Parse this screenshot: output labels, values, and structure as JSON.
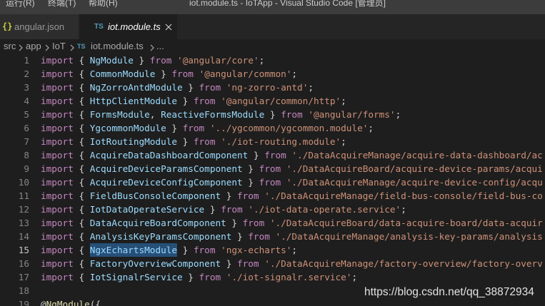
{
  "titlebar": {
    "menu": [
      "运行(R)",
      "终端(T)",
      "帮助(H)"
    ],
    "title": "iot.module.ts - IoTApp - Visual Studio Code [管理员]"
  },
  "tabs": [
    {
      "icon": "json-file-icon",
      "icon_glyph": "{}",
      "icon_color": "#cbcb41",
      "label": "angular.json",
      "active": false
    },
    {
      "icon": "typescript-file-icon",
      "icon_glyph": "TS",
      "icon_color": "#519aba",
      "label": "iot.module.ts",
      "active": true,
      "close_icon": "close-icon"
    }
  ],
  "breadcrumb": {
    "items": [
      "src",
      "app",
      "IoT",
      "iot.module.ts",
      "..."
    ],
    "separator_icon": "chevron-right-icon",
    "file_icon": "typescript-file-icon",
    "file_icon_glyph": "TS",
    "file_icon_color": "#519aba"
  },
  "editor": {
    "lines": [
      {
        "number": "1",
        "tokens": [
          {
            "text": "import",
            "color": "#c586c0"
          },
          {
            "text": " { ",
            "color": "#d4d4d4"
          },
          {
            "text": "NgModule",
            "color": "#9cdcfe"
          },
          {
            "text": " } ",
            "color": "#d4d4d4"
          },
          {
            "text": "from",
            "color": "#c586c0"
          },
          {
            "text": " ",
            "color": "#d4d4d4"
          },
          {
            "text": "'@angular/core'",
            "color": "#ce9178"
          },
          {
            "text": ";",
            "color": "#d4d4d4"
          }
        ]
      },
      {
        "number": "2",
        "tokens": [
          {
            "text": "import",
            "color": "#c586c0"
          },
          {
            "text": " { ",
            "color": "#d4d4d4"
          },
          {
            "text": "CommonModule",
            "color": "#9cdcfe"
          },
          {
            "text": " } ",
            "color": "#d4d4d4"
          },
          {
            "text": "from",
            "color": "#c586c0"
          },
          {
            "text": " ",
            "color": "#d4d4d4"
          },
          {
            "text": "'@angular/common'",
            "color": "#ce9178"
          },
          {
            "text": ";",
            "color": "#d4d4d4"
          }
        ]
      },
      {
        "number": "3",
        "tokens": [
          {
            "text": "import",
            "color": "#c586c0"
          },
          {
            "text": " { ",
            "color": "#d4d4d4"
          },
          {
            "text": "NgZorroAntdModule",
            "color": "#9cdcfe"
          },
          {
            "text": " } ",
            "color": "#d4d4d4"
          },
          {
            "text": "from",
            "color": "#c586c0"
          },
          {
            "text": " ",
            "color": "#d4d4d4"
          },
          {
            "text": "'ng-zorro-antd'",
            "color": "#ce9178"
          },
          {
            "text": ";",
            "color": "#d4d4d4"
          }
        ]
      },
      {
        "number": "4",
        "tokens": [
          {
            "text": "import",
            "color": "#c586c0"
          },
          {
            "text": " { ",
            "color": "#d4d4d4"
          },
          {
            "text": "HttpClientModule",
            "color": "#9cdcfe"
          },
          {
            "text": " } ",
            "color": "#d4d4d4"
          },
          {
            "text": "from",
            "color": "#c586c0"
          },
          {
            "text": " ",
            "color": "#d4d4d4"
          },
          {
            "text": "'@angular/common/http'",
            "color": "#ce9178"
          },
          {
            "text": ";",
            "color": "#d4d4d4"
          }
        ]
      },
      {
        "number": "5",
        "tokens": [
          {
            "text": "import",
            "color": "#c586c0"
          },
          {
            "text": " { ",
            "color": "#d4d4d4"
          },
          {
            "text": "FormsModule",
            "color": "#9cdcfe"
          },
          {
            "text": ", ",
            "color": "#d4d4d4"
          },
          {
            "text": "ReactiveFormsModule",
            "color": "#9cdcfe"
          },
          {
            "text": " } ",
            "color": "#d4d4d4"
          },
          {
            "text": "from",
            "color": "#c586c0"
          },
          {
            "text": " ",
            "color": "#d4d4d4"
          },
          {
            "text": "'@angular/forms'",
            "color": "#ce9178"
          },
          {
            "text": ";",
            "color": "#d4d4d4"
          }
        ]
      },
      {
        "number": "6",
        "tokens": [
          {
            "text": "import",
            "color": "#c586c0"
          },
          {
            "text": " { ",
            "color": "#d4d4d4"
          },
          {
            "text": "YgcommonModule",
            "color": "#9cdcfe"
          },
          {
            "text": " } ",
            "color": "#d4d4d4"
          },
          {
            "text": "from",
            "color": "#c586c0"
          },
          {
            "text": " ",
            "color": "#d4d4d4"
          },
          {
            "text": "'../ygcommon/ygcommon.module'",
            "color": "#ce9178"
          },
          {
            "text": ";",
            "color": "#d4d4d4"
          }
        ]
      },
      {
        "number": "7",
        "tokens": [
          {
            "text": "import",
            "color": "#c586c0"
          },
          {
            "text": " { ",
            "color": "#d4d4d4"
          },
          {
            "text": "IotRoutingModule",
            "color": "#9cdcfe"
          },
          {
            "text": " } ",
            "color": "#d4d4d4"
          },
          {
            "text": "from",
            "color": "#c586c0"
          },
          {
            "text": " ",
            "color": "#d4d4d4"
          },
          {
            "text": "'./iot-routing.module'",
            "color": "#ce9178"
          },
          {
            "text": ";",
            "color": "#d4d4d4"
          }
        ]
      },
      {
        "number": "8",
        "tokens": [
          {
            "text": "import",
            "color": "#c586c0"
          },
          {
            "text": " { ",
            "color": "#d4d4d4"
          },
          {
            "text": "AcquireDataDashboardComponent",
            "color": "#9cdcfe"
          },
          {
            "text": " } ",
            "color": "#d4d4d4"
          },
          {
            "text": "from",
            "color": "#c586c0"
          },
          {
            "text": " ",
            "color": "#d4d4d4"
          },
          {
            "text": "'./DataAcquireManage/acquire-data-dashboard/ac",
            "color": "#ce9178"
          }
        ]
      },
      {
        "number": "9",
        "tokens": [
          {
            "text": "import",
            "color": "#c586c0"
          },
          {
            "text": " { ",
            "color": "#d4d4d4"
          },
          {
            "text": "AcquireDeviceParamsComponent",
            "color": "#9cdcfe"
          },
          {
            "text": " } ",
            "color": "#d4d4d4"
          },
          {
            "text": "from",
            "color": "#c586c0"
          },
          {
            "text": " ",
            "color": "#d4d4d4"
          },
          {
            "text": "'./DataAcquireBoard/acquire-device-params/acqui",
            "color": "#ce9178"
          }
        ]
      },
      {
        "number": "10",
        "tokens": [
          {
            "text": "import",
            "color": "#c586c0"
          },
          {
            "text": " { ",
            "color": "#d4d4d4"
          },
          {
            "text": "AcquireDeviceConfigComponent",
            "color": "#9cdcfe"
          },
          {
            "text": " } ",
            "color": "#d4d4d4"
          },
          {
            "text": "from",
            "color": "#c586c0"
          },
          {
            "text": " ",
            "color": "#d4d4d4"
          },
          {
            "text": "'./DataAcquireManage/acquire-device-config/acqu",
            "color": "#ce9178"
          }
        ]
      },
      {
        "number": "11",
        "tokens": [
          {
            "text": "import",
            "color": "#c586c0"
          },
          {
            "text": " { ",
            "color": "#d4d4d4"
          },
          {
            "text": "FieldBusConsoleComponent",
            "color": "#9cdcfe"
          },
          {
            "text": " } ",
            "color": "#d4d4d4"
          },
          {
            "text": "from",
            "color": "#c586c0"
          },
          {
            "text": " ",
            "color": "#d4d4d4"
          },
          {
            "text": "'./DataAcquireManage/field-bus-console/field-bus-co",
            "color": "#ce9178"
          }
        ]
      },
      {
        "number": "12",
        "tokens": [
          {
            "text": "import",
            "color": "#c586c0"
          },
          {
            "text": " { ",
            "color": "#d4d4d4"
          },
          {
            "text": "IotDataOperateService",
            "color": "#9cdcfe"
          },
          {
            "text": " } ",
            "color": "#d4d4d4"
          },
          {
            "text": "from",
            "color": "#c586c0"
          },
          {
            "text": " ",
            "color": "#d4d4d4"
          },
          {
            "text": "'./iot-data-operate.service'",
            "color": "#ce9178"
          },
          {
            "text": ";",
            "color": "#d4d4d4"
          }
        ]
      },
      {
        "number": "13",
        "tokens": [
          {
            "text": "import",
            "color": "#c586c0"
          },
          {
            "text": " { ",
            "color": "#d4d4d4"
          },
          {
            "text": "DataAcquireBoardComponent",
            "color": "#9cdcfe"
          },
          {
            "text": " } ",
            "color": "#d4d4d4"
          },
          {
            "text": "from",
            "color": "#c586c0"
          },
          {
            "text": " ",
            "color": "#d4d4d4"
          },
          {
            "text": "'./DataAcquireBoard/data-acquire-board/data-acquir",
            "color": "#ce9178"
          }
        ]
      },
      {
        "number": "14",
        "tokens": [
          {
            "text": "import",
            "color": "#c586c0"
          },
          {
            "text": " { ",
            "color": "#d4d4d4"
          },
          {
            "text": "AnalysisKeyParamsComponent",
            "color": "#9cdcfe"
          },
          {
            "text": " } ",
            "color": "#d4d4d4"
          },
          {
            "text": "from",
            "color": "#c586c0"
          },
          {
            "text": " ",
            "color": "#d4d4d4"
          },
          {
            "text": "'./DataAcquireManage/analysis-key-params/analysis",
            "color": "#ce9178"
          }
        ]
      },
      {
        "number": "15",
        "active": true,
        "tokens": [
          {
            "text": "import",
            "color": "#c586c0"
          },
          {
            "text": " { ",
            "color": "#d4d4d4"
          },
          {
            "text": "NgxEchartsModule",
            "color": "#9cdcfe",
            "selection": "#264f78"
          },
          {
            "text": " } ",
            "color": "#d4d4d4"
          },
          {
            "text": "from",
            "color": "#c586c0"
          },
          {
            "text": " ",
            "color": "#d4d4d4"
          },
          {
            "text": "'ngx-echarts'",
            "color": "#ce9178"
          },
          {
            "text": ";",
            "color": "#d4d4d4"
          }
        ]
      },
      {
        "number": "16",
        "tokens": [
          {
            "text": "import",
            "color": "#c586c0"
          },
          {
            "text": " { ",
            "color": "#d4d4d4"
          },
          {
            "text": "FactoryOverviewComponent",
            "color": "#9cdcfe"
          },
          {
            "text": " } ",
            "color": "#d4d4d4"
          },
          {
            "text": "from",
            "color": "#c586c0"
          },
          {
            "text": " ",
            "color": "#d4d4d4"
          },
          {
            "text": "'./DataAcquireManage/factory-overview/factory-overv",
            "color": "#ce9178"
          }
        ]
      },
      {
        "number": "17",
        "tokens": [
          {
            "text": "import",
            "color": "#c586c0"
          },
          {
            "text": " { ",
            "color": "#d4d4d4"
          },
          {
            "text": "IotSignalrService",
            "color": "#9cdcfe"
          },
          {
            "text": " } ",
            "color": "#d4d4d4"
          },
          {
            "text": "from",
            "color": "#c586c0"
          },
          {
            "text": " ",
            "color": "#d4d4d4"
          },
          {
            "text": "'./iot-signalr.service'",
            "color": "#ce9178"
          },
          {
            "text": ";",
            "color": "#d4d4d4"
          }
        ]
      },
      {
        "number": "18",
        "tokens": []
      },
      {
        "number": "19",
        "tokens": [
          {
            "text": "@",
            "color": "#d4d4d4"
          },
          {
            "text": "NgModule",
            "color": "#dcdcaa"
          },
          {
            "text": "({",
            "color": "#d4d4d4"
          }
        ]
      }
    ]
  },
  "watermark": "https://blog.csdn.net/qq_38872934"
}
